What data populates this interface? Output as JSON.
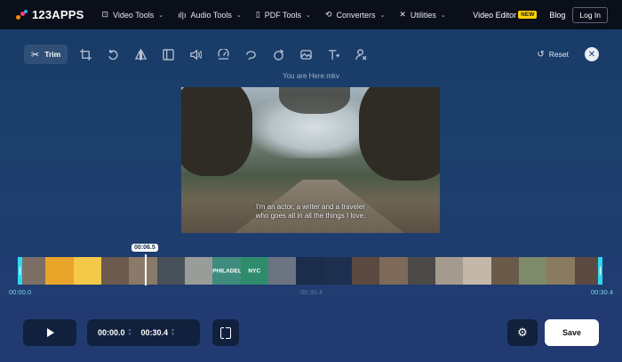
{
  "header": {
    "logo_text": "123APPS",
    "nav": [
      {
        "label": "Video Tools",
        "icon": "play-square-icon"
      },
      {
        "label": "Audio Tools",
        "icon": "waveform-icon"
      },
      {
        "label": "PDF Tools",
        "icon": "document-icon"
      },
      {
        "label": "Converters",
        "icon": "convert-icon"
      },
      {
        "label": "Utilities",
        "icon": "tools-icon"
      }
    ],
    "video_editor_label": "Video Editor",
    "new_badge": "NEW",
    "blog_label": "Blog",
    "login_label": "Log In"
  },
  "toolbar": {
    "trim_label": "Trim",
    "tools": [
      "crop-icon",
      "rotate-icon",
      "flip-icon",
      "resize-icon",
      "volume-icon",
      "speed-icon",
      "loop-icon",
      "stabilize-icon",
      "image-icon",
      "text-icon",
      "remove-logo-icon"
    ],
    "reset_label": "Reset"
  },
  "video": {
    "filename": "You are Here.mkv",
    "subtitle_line1": "I'm an actor, a writer and a traveler",
    "subtitle_line2": "who goes all in all the things I love."
  },
  "timeline": {
    "playhead_time": "00:06.5",
    "start_time": "00:00.0",
    "mid_time": "00:30.4",
    "end_time": "00:30.4",
    "frames": [
      {
        "color": "#7b6f65",
        "label": ""
      },
      {
        "color": "#e9a52a",
        "label": ""
      },
      {
        "color": "#f4c94a",
        "label": ""
      },
      {
        "color": "#6b5a4d",
        "label": ""
      },
      {
        "color": "#8a7a6a",
        "label": ""
      },
      {
        "color": "#48505a",
        "label": ""
      },
      {
        "color": "#9a9c99",
        "label": ""
      },
      {
        "color": "#3f8b7d",
        "label": "PHILADELPHIA"
      },
      {
        "color": "#2e8c6d",
        "label": "NYC"
      },
      {
        "color": "#6b7480",
        "label": ""
      },
      {
        "color": "#1a2d4a",
        "label": ""
      },
      {
        "color": "#1d2f4f",
        "label": ""
      },
      {
        "color": "#5a4a40",
        "label": ""
      },
      {
        "color": "#7d6a5a",
        "label": ""
      },
      {
        "color": "#4c4a48",
        "label": ""
      },
      {
        "color": "#a59a8e",
        "label": ""
      },
      {
        "color": "#c4b7a7",
        "label": ""
      },
      {
        "color": "#6a5a4a",
        "label": ""
      },
      {
        "color": "#7f8a6a",
        "label": ""
      },
      {
        "color": "#8a7a5e",
        "label": ""
      },
      {
        "color": "#5a4a42",
        "label": ""
      }
    ]
  },
  "controls": {
    "start_time": "00:00.0",
    "end_time": "00:30.4",
    "save_label": "Save"
  }
}
